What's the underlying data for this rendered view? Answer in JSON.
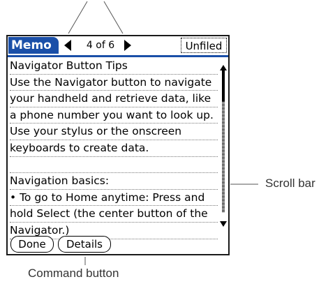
{
  "titlebar": {
    "app_name": "Memo",
    "record_count": "4 of 6",
    "category": "Unfiled"
  },
  "memo": {
    "lines": [
      "Navigator Button Tips",
      "Use the Navigator button to navigate",
      "your handheld and retrieve data, like",
      "a phone number you want to look up.",
      "Use your stylus or the onscreen",
      "keyboards to create data.",
      "",
      "Navigation basics:",
      "• To go to Home anytime: Press and",
      "hold Select (the center button of the",
      "Navigator.)"
    ]
  },
  "scroll": {
    "position": 0.1
  },
  "buttons": {
    "done": "Done",
    "details": "Details"
  },
  "callouts": {
    "scroll_bar": "Scroll bar",
    "command_button": "Command button"
  },
  "icons": {
    "prev": "triangle-left-icon",
    "next": "triangle-right-icon",
    "scroll_up": "scroll-up-arrow-icon",
    "scroll_down": "scroll-down-arrow-icon"
  },
  "colors": {
    "titlebar_accent": "#1a4fa8"
  }
}
